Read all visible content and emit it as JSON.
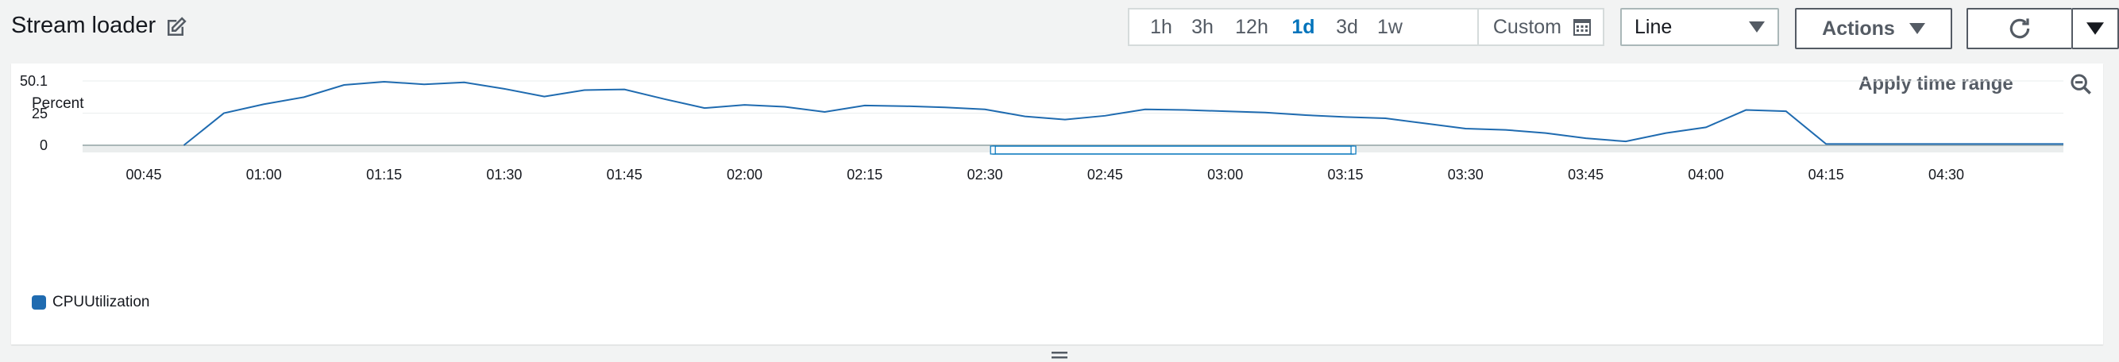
{
  "widget": {
    "title": "Stream loader",
    "apply_time_range": "Apply time range",
    "y_label": "Percent"
  },
  "time_ranges": [
    {
      "label": "1h",
      "active": false
    },
    {
      "label": "3h",
      "active": false
    },
    {
      "label": "12h",
      "active": false
    },
    {
      "label": "1d",
      "active": true
    },
    {
      "label": "3d",
      "active": false
    },
    {
      "label": "1w",
      "active": false
    }
  ],
  "custom_label": "Custom",
  "chart_type_select": {
    "value": "Line"
  },
  "actions_button": {
    "label": "Actions"
  },
  "colors": {
    "accent": "#0073bb",
    "series": "#1f6bb0",
    "grid": "#eaeded"
  },
  "icons": {
    "edit": "edit-icon",
    "calendar": "calendar-icon",
    "refresh": "refresh-icon",
    "dropdown": "caret-down-icon",
    "zoom_out": "zoom-out-icon",
    "drag": "drag-handle-icon"
  },
  "chart_data": {
    "type": "line",
    "ylabel": "Percent",
    "ylim": [
      0,
      50.1
    ],
    "y_ticks": [
      "0",
      "25",
      "50.1"
    ],
    "x_tick_labels": [
      "00:45",
      "01:00",
      "01:15",
      "01:30",
      "01:45",
      "02:00",
      "02:15",
      "02:30",
      "02:45",
      "03:00",
      "03:15",
      "03:30",
      "03:45",
      "04:00",
      "04:15",
      "04:30"
    ],
    "grid": true,
    "legend_position": "bottom-left",
    "series": [
      {
        "name": "CPUUtilization",
        "x": [
          "00:50",
          "00:55",
          "01:00",
          "01:05",
          "01:10",
          "01:15",
          "01:20",
          "01:25",
          "01:30",
          "01:35",
          "01:40",
          "01:45",
          "01:50",
          "01:55",
          "02:00",
          "02:05",
          "02:10",
          "02:15",
          "02:20",
          "02:25",
          "02:30",
          "02:35",
          "02:40",
          "02:45",
          "02:50",
          "02:55",
          "03:00",
          "03:05",
          "03:10",
          "03:15",
          "03:20",
          "03:25",
          "03:30",
          "03:35",
          "03:40",
          "03:45",
          "03:50",
          "03:55",
          "04:00",
          "04:05",
          "04:10",
          "04:15",
          "04:20",
          "04:25",
          "04:30",
          "04:35",
          "04:40"
        ],
        "values": [
          0,
          25,
          32,
          37.5,
          47,
          49.5,
          47.5,
          49,
          44,
          38,
          43,
          43.5,
          36,
          29,
          31.5,
          30,
          26,
          31,
          30.5,
          29.5,
          28,
          22.5,
          20,
          23,
          28,
          27.5,
          26.5,
          25.5,
          23.5,
          22,
          21,
          17,
          13,
          12,
          9.5,
          5.5,
          3,
          9.5,
          14,
          27.5,
          26.5,
          1,
          1,
          1,
          1,
          1,
          1
        ]
      }
    ],
    "selection_window": [
      "02:31",
      "03:16"
    ]
  },
  "legend": {
    "label": "CPUUtilization"
  }
}
